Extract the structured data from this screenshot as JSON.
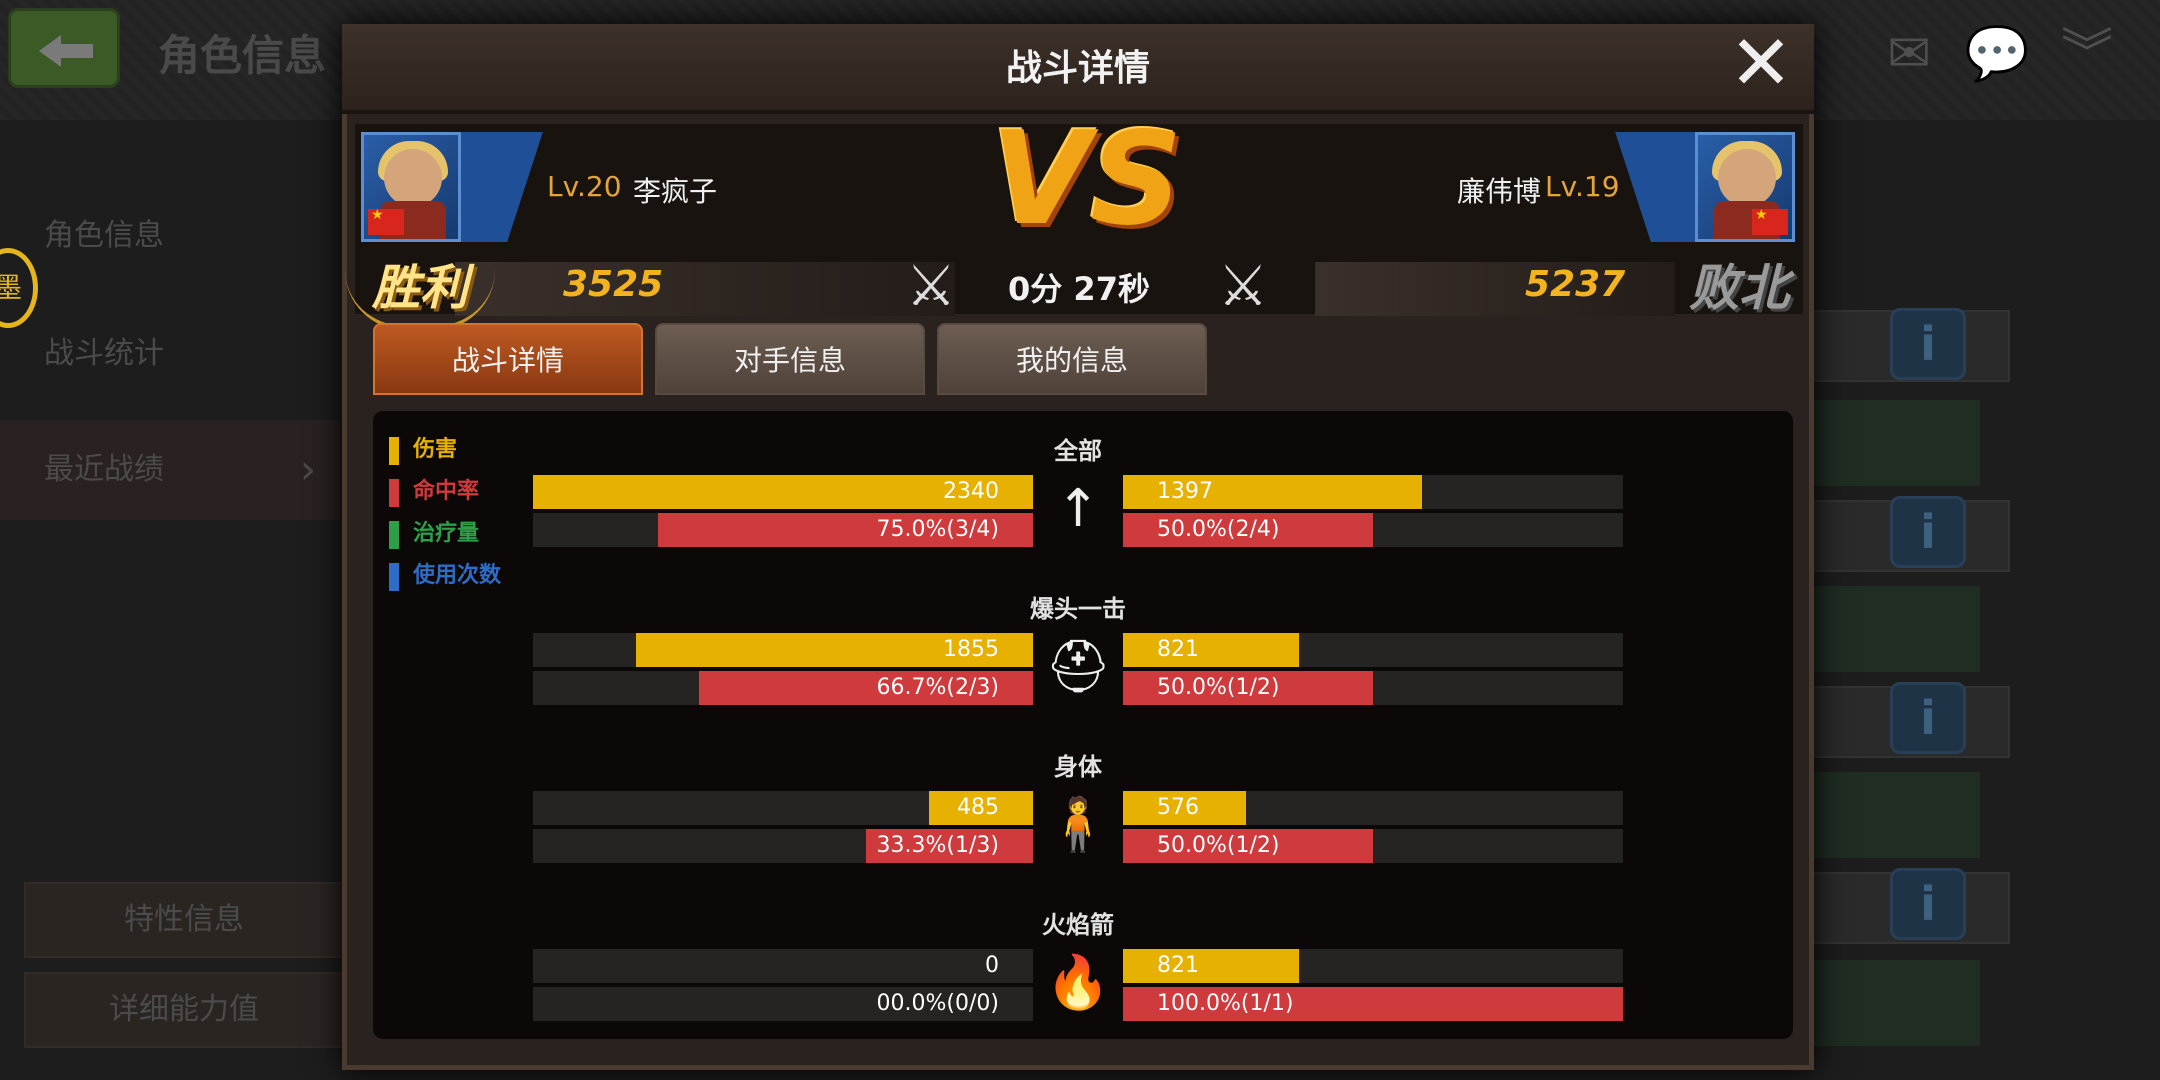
{
  "background": {
    "title": "角色信息",
    "sidebar": [
      "角色信息",
      "战斗统计",
      "最近战绩"
    ],
    "medal_char": "墨",
    "buttons": [
      "特性信息",
      "详细能力值"
    ]
  },
  "modal": {
    "title": "战斗详情",
    "close_icon": "close-icon"
  },
  "player_left": {
    "level": "Lv.20",
    "name": "李疯子",
    "score": "3525",
    "result": "胜利"
  },
  "player_right": {
    "level": "Lv.19",
    "name": "廉伟博",
    "score": "5237",
    "result": "败北"
  },
  "vs_text": "VS",
  "duration": "0分 27秒",
  "tabs": [
    {
      "label": "战斗详情",
      "active": true
    },
    {
      "label": "对手信息",
      "active": false
    },
    {
      "label": "我的信息",
      "active": false
    }
  ],
  "legend": [
    {
      "label": "伤害",
      "color": "#e6b100"
    },
    {
      "label": "命中率",
      "color": "#cf3a3d"
    },
    {
      "label": "治疗量",
      "color": "#2e9e4a"
    },
    {
      "label": "使用次数",
      "color": "#2d6cc9"
    }
  ],
  "sections": [
    {
      "title": "全部",
      "icon": "arrow-icon",
      "left_damage": "2340",
      "left_damage_frac": 1.0,
      "right_damage": "1397",
      "right_damage_frac": 0.597,
      "left_hit": "75.0%(3/4)",
      "left_hit_frac": 0.75,
      "right_hit": "50.0%(2/4)",
      "right_hit_frac": 0.5
    },
    {
      "title": "爆头一击",
      "icon": "helmet-icon",
      "left_damage": "1855",
      "left_damage_frac": 0.793,
      "right_damage": "821",
      "right_damage_frac": 0.351,
      "left_hit": "66.7%(2/3)",
      "left_hit_frac": 0.667,
      "right_hit": "50.0%(1/2)",
      "right_hit_frac": 0.5
    },
    {
      "title": "身体",
      "icon": "body-icon",
      "left_damage": "485",
      "left_damage_frac": 0.207,
      "right_damage": "576",
      "right_damage_frac": 0.246,
      "left_hit": "33.3%(1/3)",
      "left_hit_frac": 0.333,
      "right_hit": "50.0%(1/2)",
      "right_hit_frac": 0.5
    },
    {
      "title": "火焰箭",
      "icon": "fire-icon",
      "left_damage": "0",
      "left_damage_frac": 0.0,
      "right_damage": "821",
      "right_damage_frac": 0.351,
      "left_hit": "00.0%(0/0)",
      "left_hit_frac": 0.0,
      "right_hit": "100.0%(1/1)",
      "right_hit_frac": 1.0
    }
  ]
}
